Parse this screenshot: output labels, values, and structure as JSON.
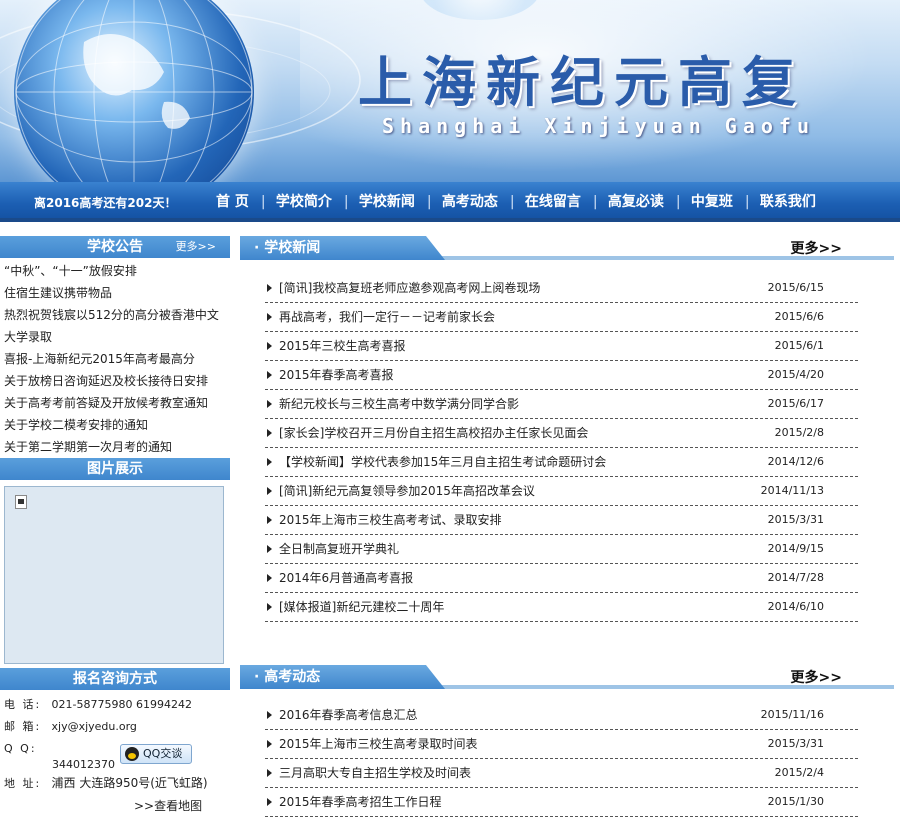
{
  "banner": {
    "title_cn": "上海新纪元高复",
    "title_en": "Shanghai Xinjiyuan Gaofu"
  },
  "nav": {
    "countdown": "离2016高考还有202天！",
    "items": [
      "首 页",
      "学校简介",
      "学校新闻",
      "高考动态",
      "在线留言",
      "高复必读",
      "中复班",
      "联系我们"
    ],
    "separator": "|"
  },
  "notice": {
    "title": "学校公告",
    "more": "更多>>",
    "items": [
      "“中秋”、“十一”放假安排",
      "住宿生建议携带物品",
      "热烈祝贺钱宸以512分的高分被香港中文",
      "大学录取",
      "喜报-上海新纪元2015年高考最高分",
      "关于放榜日咨询延迟及校长接待日安排",
      "关于高考考前答疑及开放候考教室通知",
      "关于学校二模考安排的通知",
      "关于第二学期第一次月考的通知"
    ]
  },
  "pictures": {
    "title": "图片展示"
  },
  "contact": {
    "title": "报名咨询方式",
    "phone_label": "电 话:",
    "phone": "021-58775980 61994242",
    "email_label": "邮 箱:",
    "email": "xjy@xjyedu.org",
    "qq_label": "Q  Q:",
    "qq": "344012370",
    "qq_button": "QQ交谈",
    "address_label": "地 址:",
    "address": "浦西 大连路950号(近飞虹路)",
    "map_link": ">>查看地图"
  },
  "school_news": {
    "title": "· 学校新闻",
    "more": "更多>>",
    "items": [
      {
        "text": "[简讯]我校高复班老师应邀参观高考网上阅卷现场",
        "date": "2015/6/15"
      },
      {
        "text": "再战高考，我们一定行－－记考前家长会",
        "date": "2015/6/6"
      },
      {
        "text": "2015年三校生高考喜报",
        "date": "2015/6/1"
      },
      {
        "text": "2015年春季高考喜报",
        "date": "2015/4/20"
      },
      {
        "text": "新纪元校长与三校生高考中数学满分同学合影",
        "date": "2015/6/17"
      },
      {
        "text": "[家长会]学校召开三月份自主招生高校招办主任家长见面会",
        "date": "2015/2/8"
      },
      {
        "text": "【学校新闻】学校代表参加15年三月自主招生考试命题研讨会",
        "date": "2014/12/6"
      },
      {
        "text": "[简讯]新纪元高复领导参加2015年高招改革会议",
        "date": "2014/11/13"
      },
      {
        "text": "2015年上海市三校生高考考试、录取安排",
        "date": "2015/3/31"
      },
      {
        "text": "全日制高复班开学典礼",
        "date": "2014/9/15"
      },
      {
        "text": "2014年6月普通高考喜报",
        "date": "2014/7/28"
      },
      {
        "text": "[媒体报道]新纪元建校二十周年",
        "date": "2014/6/10"
      }
    ]
  },
  "exam_news": {
    "title": "· 高考动态",
    "more": "更多>>",
    "items": [
      {
        "text": "2016年春季高考信息汇总",
        "date": "2015/11/16"
      },
      {
        "text": "2015年上海市三校生高考录取时间表",
        "date": "2015/3/31"
      },
      {
        "text": "三月高职大专自主招生学校及时间表",
        "date": "2015/2/4"
      },
      {
        "text": "2015年春季高考招生工作日程",
        "date": "2015/1/30"
      }
    ]
  }
}
